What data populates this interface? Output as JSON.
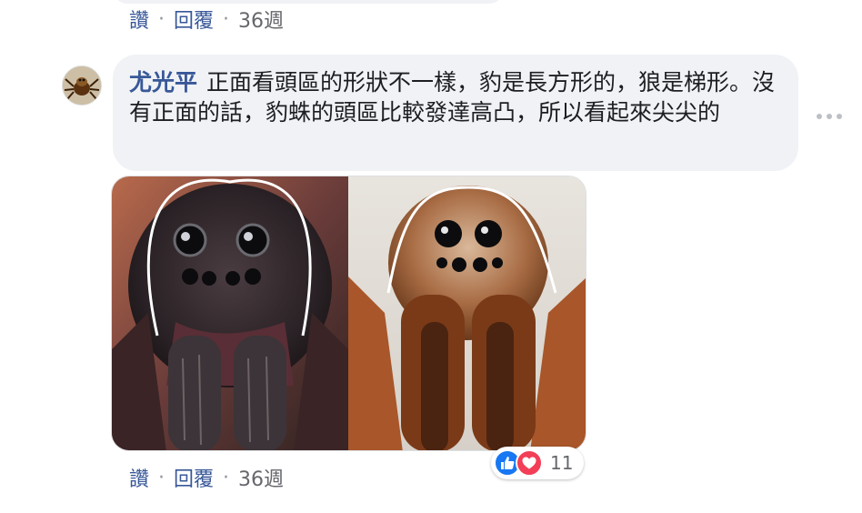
{
  "previous_comment": {
    "actions": {
      "like": "讚",
      "reply": "回覆",
      "time": "36週"
    }
  },
  "comment": {
    "author": "尤光平",
    "text": "正面看頭區的形狀不一樣，豹是長方形的，狼是梯形。沒有正面的話，豹蛛的頭區比較發達高凸，所以看起來尖尖的",
    "actions": {
      "like": "讚",
      "reply": "回覆",
      "time": "36週"
    },
    "separator": "·",
    "reactions": {
      "icons": [
        "like-icon",
        "love-icon"
      ],
      "count": "11"
    }
  },
  "colors": {
    "bubble": "#f0f2f5",
    "link": "#385898",
    "meta": "#65676b",
    "like": "#1877f2",
    "love": "#f33e58"
  }
}
